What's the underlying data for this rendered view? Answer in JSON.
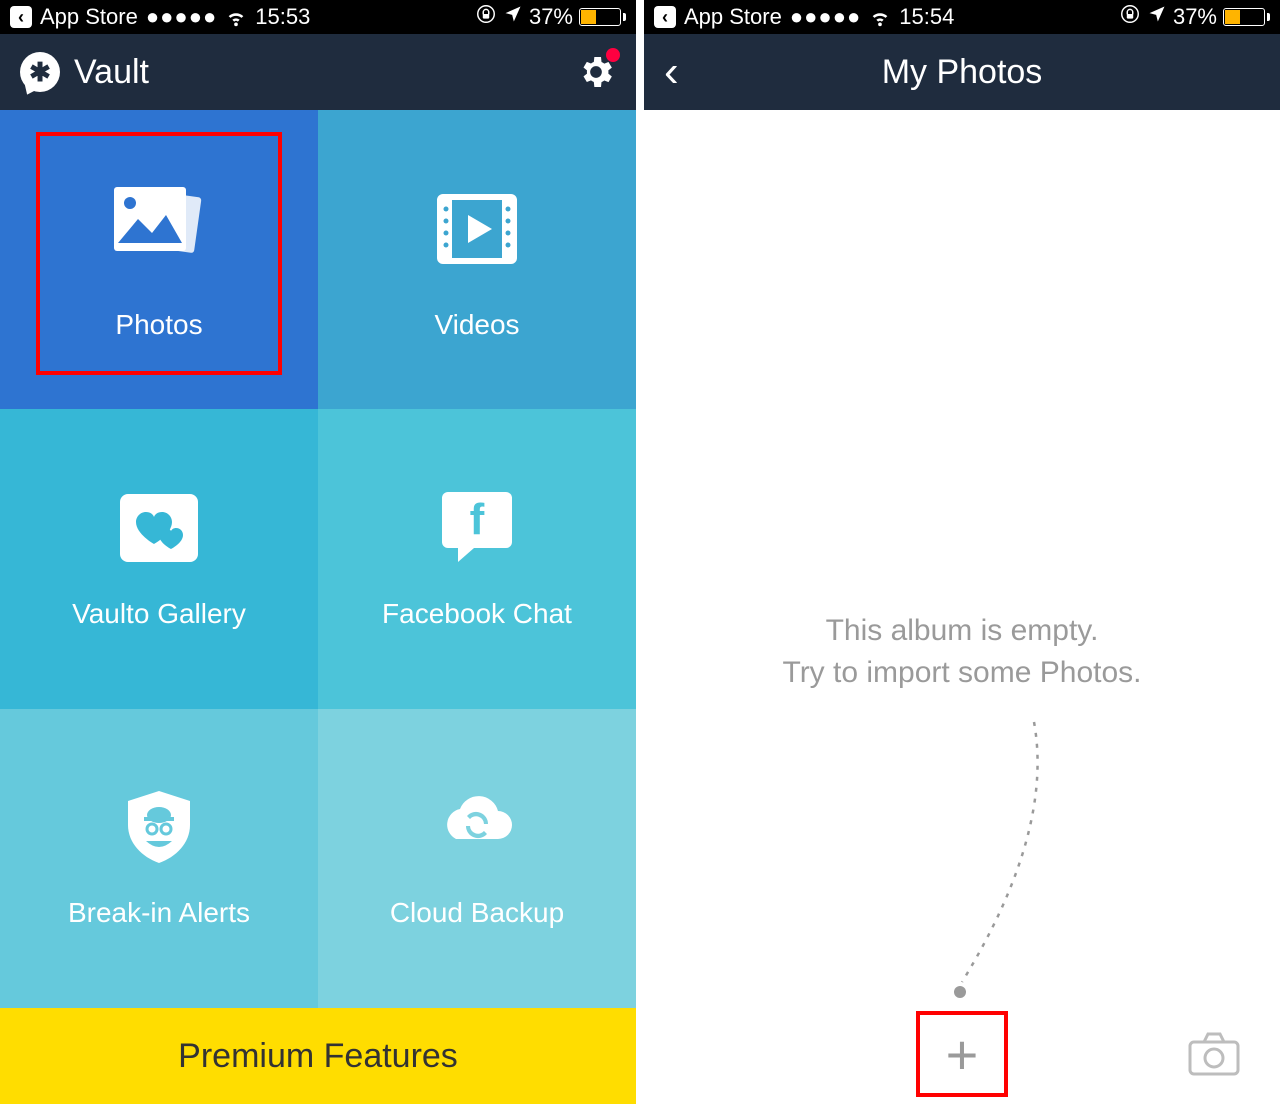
{
  "left": {
    "status": {
      "back_label": "App Store",
      "dots": "●●●●●",
      "time": "15:53",
      "battery_percent": "37%"
    },
    "header": {
      "title": "Vault"
    },
    "tiles": [
      {
        "label": "Photos",
        "icon": "photos-icon"
      },
      {
        "label": "Videos",
        "icon": "video-icon"
      },
      {
        "label": "Vaulto Gallery",
        "icon": "hearts-icon"
      },
      {
        "label": "Facebook Chat",
        "icon": "facebook-icon"
      },
      {
        "label": "Break-in Alerts",
        "icon": "shield-spy-icon"
      },
      {
        "label": "Cloud Backup",
        "icon": "cloud-sync-icon"
      }
    ],
    "premium_label": "Premium Features"
  },
  "right": {
    "status": {
      "back_label": "App Store",
      "dots": "●●●●●",
      "time": "15:54",
      "battery_percent": "37%"
    },
    "header": {
      "title": "My Photos"
    },
    "empty": {
      "line1": "This album is empty.",
      "line2": "Try to import some Photos."
    }
  }
}
